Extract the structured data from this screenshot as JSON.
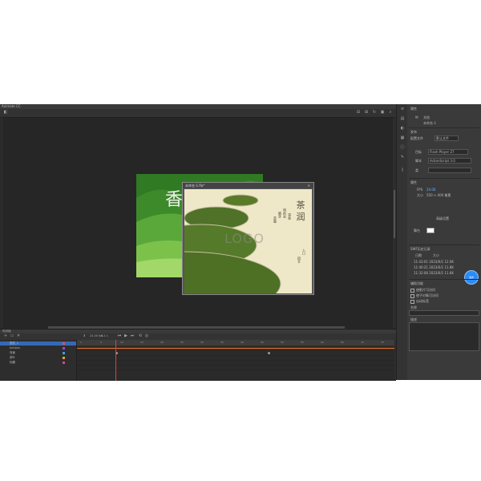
{
  "app": {
    "topbar_text": "Animate CC",
    "front_doc_title": "未命名-1.fla*"
  },
  "stage": {
    "logo_text": "LOGO",
    "poem_title": "茶 润",
    "poem_lines": [
      "清香",
      "明前采",
      "嫩芽",
      "茶露",
      "入口",
      "回甘"
    ],
    "back_calligraphy": "香"
  },
  "properties": {
    "header": "属性",
    "doc_label": "文档",
    "doc_name": "未命名-1",
    "section_publish": "发布",
    "profile_label": "配置文件",
    "profile_value": "默认文件",
    "target_label": "目标",
    "target_value": "Flash Player 27",
    "script_label": "脚本",
    "script_value": "ActionScript 3.0",
    "class_label": "类",
    "section_props": "属性",
    "fps_label": "FPS",
    "fps_value": "24.00",
    "size_label": "大小",
    "size_value": "550 × 400 像素",
    "stage_label": "舞台",
    "advanced_label": "高级设置",
    "history_header": "SWF历史记录",
    "history_cols": [
      "日期",
      "大小"
    ],
    "history_rows": [
      [
        "11:43:01",
        "2023/6/1",
        "12.0K"
      ],
      [
        "11:40:21",
        "2023/6/1",
        "11.8K"
      ],
      [
        "11:32:08",
        "2023/6/1",
        "11.6K"
      ]
    ],
    "section_accessibility": "辅助功能",
    "check1": "使影片可访问",
    "check2": "使子对象可访问",
    "check3": "自动标签",
    "name_label": "名称",
    "desc_label": "描述",
    "blue_btn": "发布"
  },
  "timeline": {
    "header": "时间轴",
    "fps_readout": "24.00 fps",
    "time_readout": "0.1 s",
    "frame_readout": "3",
    "layers": [
      {
        "name": "图层_1",
        "color": "#e05050"
      },
      {
        "name": "Actions",
        "color": "#a040e0"
      },
      {
        "name": "背景",
        "color": "#40a0e0"
      },
      {
        "name": "茶叶",
        "color": "#e0a040"
      },
      {
        "name": "标题",
        "color": "#e040a0"
      }
    ],
    "ruler_ticks": [
      "1",
      "5",
      "10",
      "15",
      "20",
      "25",
      "30",
      "35",
      "40",
      "45",
      "50",
      "55",
      "60",
      "65",
      "70",
      "75"
    ]
  },
  "colors": {
    "accent": "#2a8cf7",
    "playhead": "#e04040",
    "layer_selected": "#3569b8",
    "frame_orange": "#d9733a"
  }
}
